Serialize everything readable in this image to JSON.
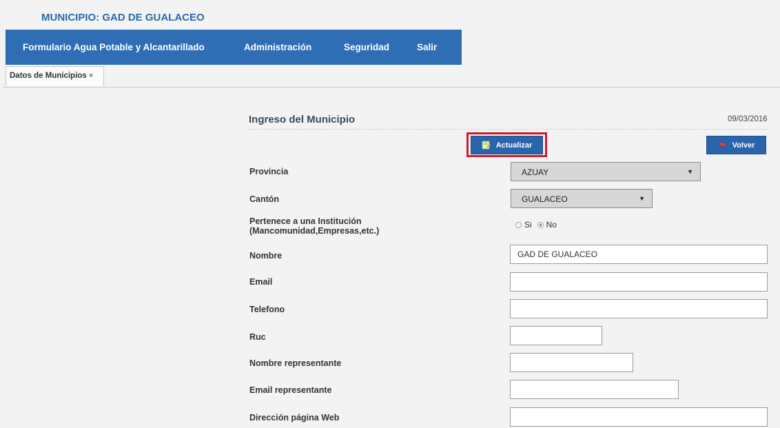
{
  "header": {
    "municipio_title": "MUNICIPIO: GAD DE GUALACEO"
  },
  "menu": {
    "items": [
      {
        "label": "Formulario Agua Potable y Alcantarillado"
      },
      {
        "label": "Administración"
      },
      {
        "label": "Seguridad"
      },
      {
        "label": "Salir"
      }
    ]
  },
  "tabs": [
    {
      "label": "Datos de Municipios",
      "close": "×"
    }
  ],
  "form": {
    "title": "Ingreso del Municipio",
    "date": "09/03/2016",
    "actualizar_label": "Actualizar",
    "volver_label": "Volver",
    "fields": {
      "provincia": {
        "label": "Provincia",
        "value": "AZUAY"
      },
      "canton": {
        "label": "Cantón",
        "value": "GUALACEO"
      },
      "pertenece": {
        "label_line1": "Pertenece a una Institución",
        "label_line2": "(Mancomunidad,Empresas,etc.)",
        "options": [
          "Si",
          "No"
        ],
        "selected": "No"
      },
      "nombre": {
        "label": "Nombre",
        "value": "GAD DE GUALACEO"
      },
      "email": {
        "label": "Email",
        "value": ""
      },
      "telefono": {
        "label": "Telefono",
        "value": ""
      },
      "ruc": {
        "label": "Ruc",
        "value": ""
      },
      "nombre_representante": {
        "label": "Nombre representante",
        "value": ""
      },
      "email_representante": {
        "label": "Email representante",
        "value": ""
      },
      "direccion_web": {
        "label": "Dirección página Web",
        "value": ""
      }
    }
  },
  "colors": {
    "menu_bg": "#2f6db4",
    "title_blue": "#2a6aa8",
    "button_bg": "#2a64ad",
    "highlight": "#d11a2a"
  },
  "icons": [
    "update-icon",
    "back-arrow-icon",
    "close-icon",
    "dropdown-caret-icon"
  ]
}
